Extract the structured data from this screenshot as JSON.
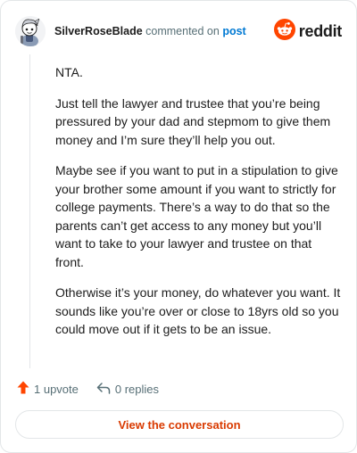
{
  "header": {
    "username": "SilverRoseBlade",
    "action_text": " commented on ",
    "post_link": "post",
    "brand_name": "reddit",
    "brand_icon": "reddit-logo",
    "avatar_icon": "user-avatar"
  },
  "comment": {
    "paragraphs": [
      "NTA.",
      "Just tell the lawyer and trustee that you’re being pressured by your dad and stepmom to give them money and I’m sure they’ll help you out.",
      "Maybe see if you want to put in a stipulation to give your brother some amount if you want to strictly for college payments. There’s a way to do that so the parents can’t get access to any money but you’ll want to take to your lawyer and trustee on that front.",
      "Otherwise it’s your money, do whatever you want. It sounds like you’re over or close to 18yrs old so you could move out if it gets to be an issue."
    ]
  },
  "actions": {
    "upvote_label": "1 upvote",
    "replies_label": "0 replies",
    "upvote_icon": "upvote-arrow",
    "reply_icon": "reply-arrow"
  },
  "cta": {
    "view_label": "View the conversation"
  },
  "colors": {
    "brand_orange": "#ff4500",
    "link_blue": "#0079d3",
    "cta_text": "#d93a00",
    "muted": "#576f76"
  }
}
